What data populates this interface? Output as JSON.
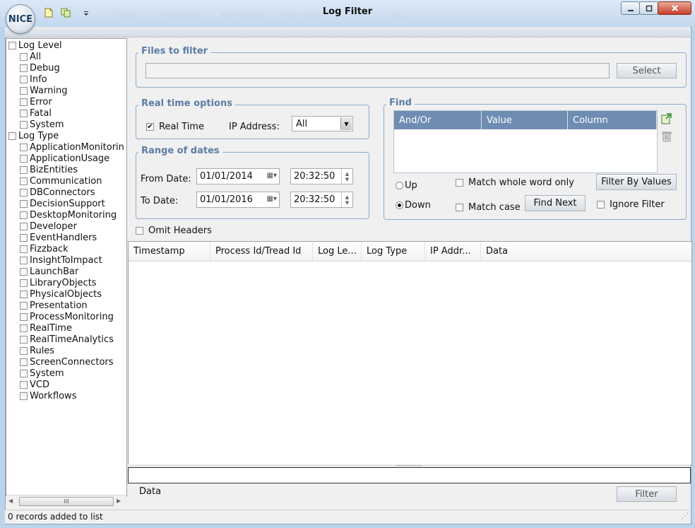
{
  "window": {
    "title": "Log Filter",
    "logo_text": "NICE",
    "ribbon_ghost_tabs": [
      "Design",
      "Transitions",
      "Animations",
      "Slide Show",
      "View"
    ]
  },
  "tree": {
    "groups": [
      {
        "label": "Log Level",
        "items": [
          "All",
          "Debug",
          "Info",
          "Warning",
          "Error",
          "Fatal",
          "System"
        ]
      },
      {
        "label": "Log Type",
        "items": [
          "ApplicationMonitorin",
          "ApplicationUsage",
          "BizEntities",
          "Communication",
          "DBConnectors",
          "DecisionSupport",
          "DesktopMonitoring",
          "Developer",
          "EventHandlers",
          "Fizzback",
          "InsightToImpact",
          "LaunchBar",
          "LibraryObjects",
          "PhysicalObjects",
          "Presentation",
          "ProcessMonitoring",
          "RealTime",
          "RealTimeAnalytics",
          "Rules",
          "ScreenConnectors",
          "System",
          "VCD",
          "Workflows"
        ]
      }
    ],
    "scroll_thumb": "III"
  },
  "files": {
    "title": "Files to filter",
    "path_value": "",
    "select_label": "Select"
  },
  "realtime": {
    "title": "Real time options",
    "checkbox_label": "Real Time",
    "checked": true,
    "ip_label": "IP Address:",
    "ip_value": "All"
  },
  "dates": {
    "title": "Range of dates",
    "from_label": "From Date:",
    "from_date": "01/01/2014",
    "from_time": "20:32:50",
    "to_label": "To Date:",
    "to_date": "01/01/2016",
    "to_time": "20:32:50"
  },
  "find": {
    "title": "Find",
    "columns": [
      "And/Or",
      "Value",
      "Column"
    ],
    "up_label": "Up",
    "down_label": "Down",
    "direction": "Down",
    "match_whole_word": "Match whole word only",
    "match_case": "Match case",
    "ignore_filter": "Ignore Filter",
    "filter_by_values": "Filter By Values",
    "find_next": "Find Next",
    "header_color": "#6f8db2"
  },
  "omit_headers": "Omit Headers",
  "grid": {
    "columns": [
      "Timestamp",
      "Process Id/Tread Id",
      "Log Le...",
      "Log Type",
      "IP Addr...",
      "Data"
    ]
  },
  "bottom": {
    "data_label": "Data",
    "filter_label": "Filter"
  },
  "status": "0 records added to list"
}
